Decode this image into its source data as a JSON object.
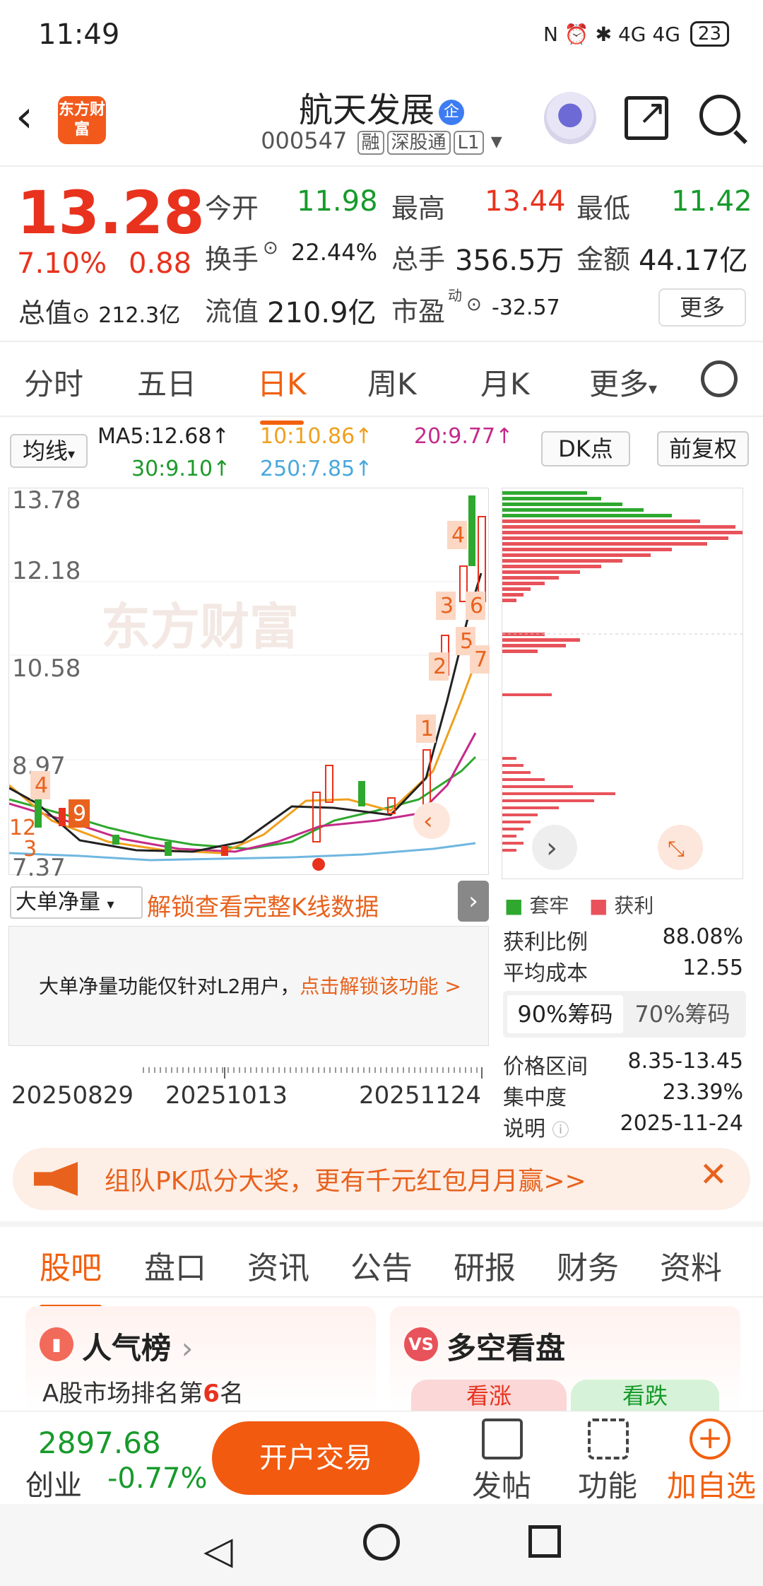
{
  "status": {
    "time": "11:49",
    "icons": "N ⏰ ✱ 4G 4G",
    "battery": "23"
  },
  "header": {
    "title": "航天发展",
    "badge": "企",
    "code": "000547",
    "tag_rong": "融",
    "tag_sgt": "深股通",
    "tag_l1": "L1",
    "logo": "东方财富"
  },
  "quote": {
    "price": "13.28",
    "pct": "7.10%",
    "change": "0.88",
    "open_label": "今开",
    "open": "11.98",
    "high_label": "最高",
    "high": "13.44",
    "low_label": "最低",
    "low": "11.42",
    "turnover_label": "换手",
    "turnover": "22.44%",
    "volume_label": "总手",
    "volume": "356.5万",
    "amount_label": "金额",
    "amount": "44.17亿",
    "mcap_label": "总值",
    "mcap": "212.3亿",
    "float_label": "流值",
    "float": "210.9亿",
    "pe_label": "市盈",
    "pe_sup": "动",
    "pe": "-32.57",
    "more": "更多"
  },
  "tabs": [
    "分时",
    "五日",
    "日K",
    "周K",
    "月K",
    "更多"
  ],
  "ma": {
    "btn": "均线",
    "ma5": "MA5:12.68↑",
    "ma10": "10:10.86↑",
    "ma20": "20:9.77↑",
    "ma30": "30:9.10↑",
    "ma250": "250:7.85↑",
    "dk": "DK点",
    "fq": "前复权"
  },
  "chart_data": {
    "type": "candlestick",
    "y_ticks": [
      "13.78",
      "12.18",
      "10.58",
      "8.97",
      "7.37"
    ],
    "watermark": "东方财富",
    "x_ticks": [
      "20250829",
      "20251013",
      "20251124"
    ]
  },
  "lower": {
    "dropdown": "大单净量",
    "unlock": "解锁查看完整K线数据",
    "l2_text": "大单净量功能仅针对L2用户，",
    "l2_link": "点击解锁该功能 >"
  },
  "chip": {
    "legend_trap": "套牢",
    "legend_profit": "获利",
    "profit_ratio_label": "获利比例",
    "profit_ratio": "88.08%",
    "avg_cost_label": "平均成本",
    "avg_cost": "12.55",
    "seg90": "90%筹码",
    "seg70": "70%筹码",
    "range_label": "价格区间",
    "range": "8.35-13.45",
    "conc_label": "集中度",
    "conc": "23.39%",
    "note_label": "说明",
    "note": "2025-11-24"
  },
  "banner": {
    "text": "组队PK瓜分大奖，更有千元红包月月赢>>"
  },
  "btabs": [
    "股吧",
    "盘口",
    "资讯",
    "公告",
    "研报",
    "财务",
    "资料"
  ],
  "cards": {
    "left_title": "人气榜",
    "left_sub_a": "A股市场排名第",
    "left_rank": "6",
    "left_sub_b": "名",
    "right_title": "多空看盘",
    "bull": "看涨",
    "bear": "看跌"
  },
  "bottom": {
    "index": "2897.68",
    "index_name": "创业",
    "index_pct": "-0.77%",
    "trade": "开户交易",
    "post": "发帖",
    "func": "功能",
    "add": "加自选"
  }
}
